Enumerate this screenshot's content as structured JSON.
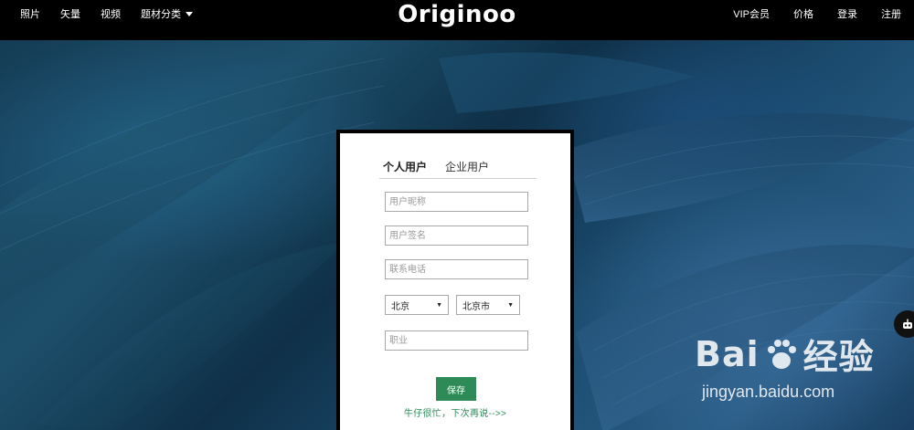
{
  "nav": {
    "left": [
      "照片",
      "矢量",
      "视频",
      "题材分类"
    ],
    "right": [
      "VIP会员",
      "价格",
      "登录",
      "注册"
    ],
    "logo": "Originoo"
  },
  "form": {
    "tabs": [
      "个人用户",
      "企业用户"
    ],
    "nickname_placeholder": "用户昵称",
    "signature_placeholder": "用户签名",
    "phone_placeholder": "联系电话",
    "province": "北京",
    "city": "北京市",
    "job_placeholder": "职业",
    "save_label": "保存",
    "skip_label": "牛仔很忙，下次再说-->>"
  },
  "watermark": {
    "brand": "Bai",
    "brand_suffix": "经验",
    "url": "jingyan.baidu.com"
  },
  "colors": {
    "accent": "#2e8b57",
    "nav_bg": "#000000"
  }
}
